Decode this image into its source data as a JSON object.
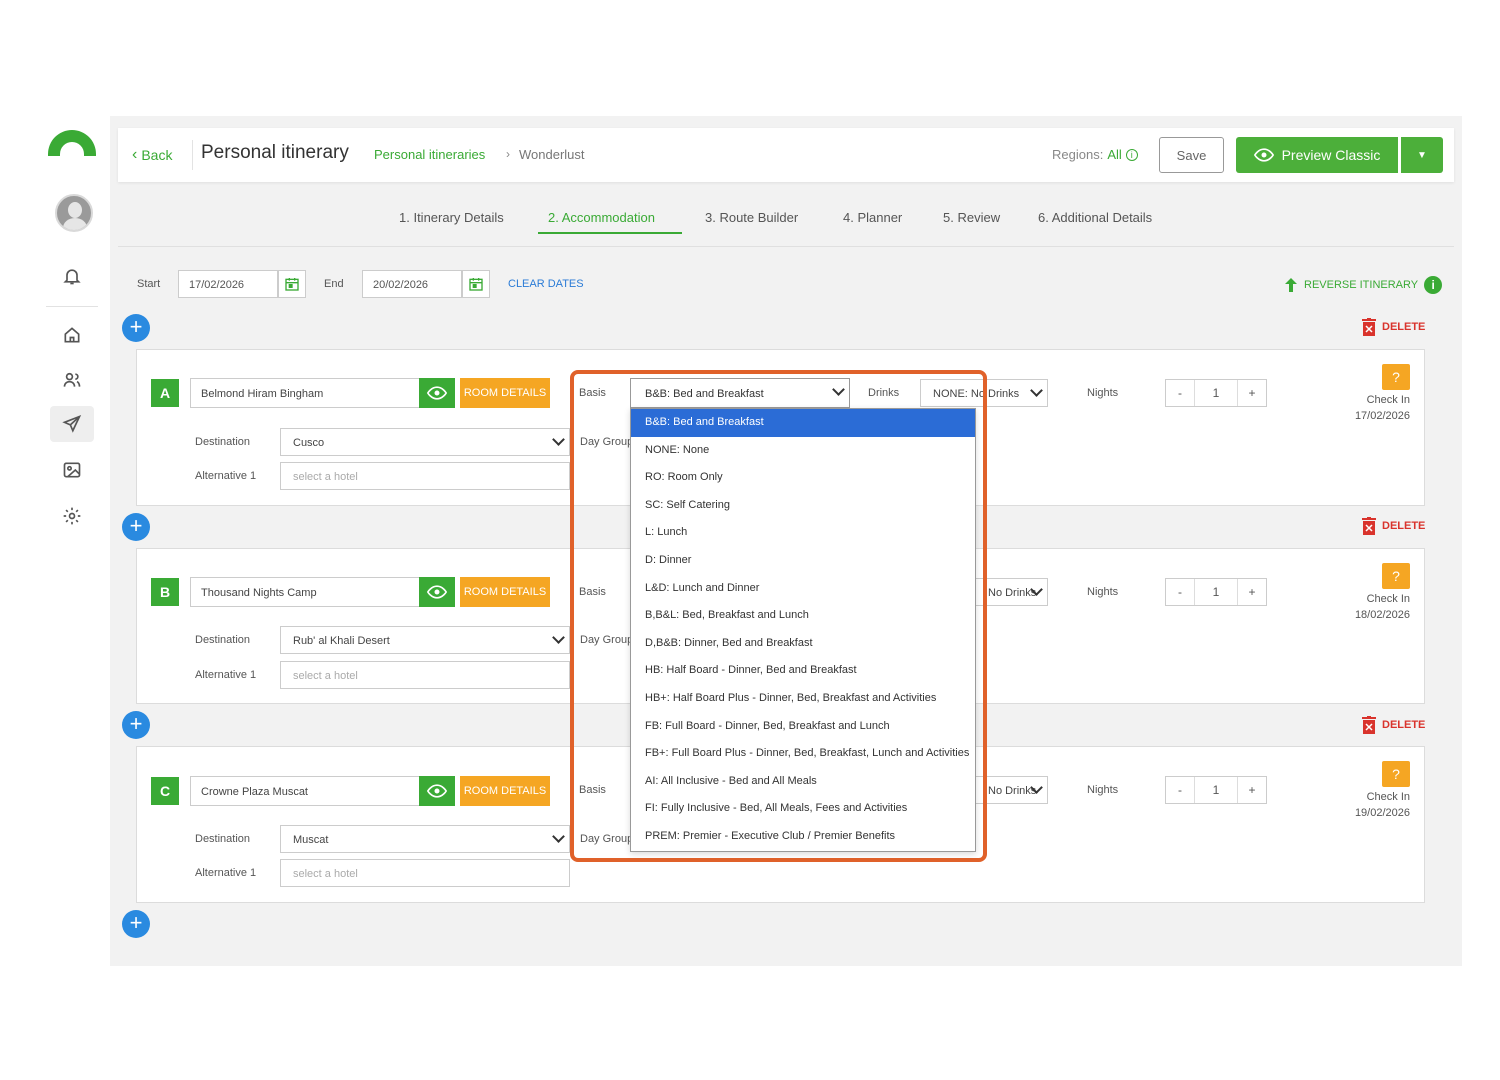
{
  "header": {
    "back_label": "Back",
    "title": "Personal itinerary",
    "breadcrumb_parent": "Personal itineraries",
    "breadcrumb_sep": "›",
    "breadcrumb_current": "Wonderlust",
    "regions_label": "Regions:",
    "regions_value": "All",
    "save_label": "Save",
    "preview_label": "Preview Classic"
  },
  "tabs": [
    {
      "label": "1. Itinerary Details",
      "active": false
    },
    {
      "label": "2. Accommodation",
      "active": true
    },
    {
      "label": "3. Route Builder",
      "active": false
    },
    {
      "label": "4. Planner",
      "active": false
    },
    {
      "label": "5. Review",
      "active": false
    },
    {
      "label": "6. Additional Details",
      "active": false
    }
  ],
  "dates": {
    "start_label": "Start",
    "start_value": "17/02/2026",
    "end_label": "End",
    "end_value": "20/02/2026",
    "clear_label": "CLEAR DATES",
    "reverse_label": "REVERSE ITINERARY"
  },
  "delete_label": "DELETE",
  "labels": {
    "destination": "Destination",
    "alternative": "Alternative 1",
    "alternative_placeholder": "select a hotel",
    "basis": "Basis",
    "day_group": "Day Group",
    "drinks": "Drinks",
    "nights": "Nights",
    "room_details": "ROOM DETAILS",
    "check_in": "Check In",
    "minus": "-",
    "plus": "+",
    "question": "?"
  },
  "segments": [
    {
      "letter": "A",
      "hotel": "Belmond Hiram Bingham",
      "destination": "Cusco",
      "drinks": "NONE: No Drinks",
      "nights": "1",
      "check_in_date": "17/02/2026"
    },
    {
      "letter": "B",
      "hotel": "Thousand Nights Camp",
      "destination": "Rub' al Khali Desert",
      "drinks": "No Drinks",
      "nights": "1",
      "check_in_date": "18/02/2026"
    },
    {
      "letter": "C",
      "hotel": "Crowne Plaza Muscat",
      "destination": "Muscat",
      "drinks": "No Drinks",
      "nights": "1",
      "check_in_date": "19/02/2026"
    }
  ],
  "basis_dropdown": {
    "selected": "B&B: Bed and Breakfast",
    "options": [
      "B&B: Bed and Breakfast",
      "NONE: None",
      "RO: Room Only",
      "SC: Self Catering",
      "L: Lunch",
      "D: Dinner",
      "L&D: Lunch and Dinner",
      "B,B&L: Bed, Breakfast and Lunch",
      "D,B&B: Dinner, Bed and Breakfast",
      "HB: Half Board - Dinner, Bed and Breakfast",
      "HB+: Half Board Plus - Dinner, Bed, Breakfast and Activities",
      "FB: Full Board - Dinner, Bed, Breakfast and Lunch",
      "FB+: Full Board Plus - Dinner, Bed, Breakfast, Lunch and Activities",
      "AI: All Inclusive - Bed and All Meals",
      "FI: Fully Inclusive - Bed, All Meals, Fees and Activities",
      "PREM: Premier - Executive Club / Premier Benefits"
    ]
  },
  "colors": {
    "brand_green": "#3aaa35",
    "accent_orange": "#f5a623",
    "link_blue": "#2a7bd6",
    "danger_red": "#d9332c",
    "highlight": "#e0612a"
  }
}
